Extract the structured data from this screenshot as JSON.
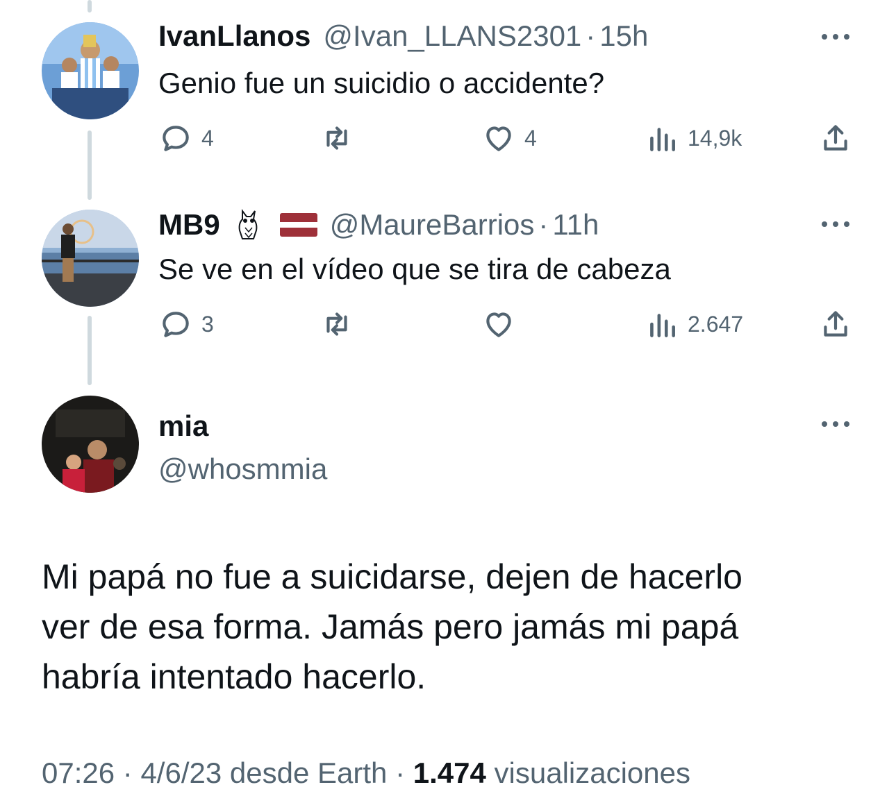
{
  "replies": [
    {
      "name": "IvanLlanos",
      "handle": "@Ivan_LLANS2301",
      "separator": "·",
      "time": "15h",
      "text": "Genio fue un suicidio o accidente?",
      "reply_count": "4",
      "retweet_count": "",
      "like_count": "4",
      "view_count": "14,9k"
    },
    {
      "name": "MB9",
      "name_emojis": [
        "owl-icon",
        "latvia-flag-icon"
      ],
      "handle": "@MaureBarrios",
      "separator": "·",
      "time": "11h",
      "text": "Se ve en el vídeo que se tira de cabeza",
      "reply_count": "3",
      "retweet_count": "",
      "like_count": "",
      "view_count": "2.647"
    }
  ],
  "main_tweet": {
    "name": "mia",
    "handle": "@whosmmia",
    "text_lines": [
      "Mi papá no fue a suicidarse, dejen de hacerlo",
      "ver de esa forma. Jamás pero jamás mi papá",
      "habría intentado hacerlo."
    ],
    "time": "07:26",
    "date": "4/6/23",
    "source": "desde Earth",
    "separator": "·",
    "views_count": "1.474",
    "views_label": "visualizaciones"
  },
  "colors": {
    "text_primary": "#0f1419",
    "text_secondary": "#536471",
    "thread_line": "#cfd9de",
    "background": "#ffffff"
  }
}
